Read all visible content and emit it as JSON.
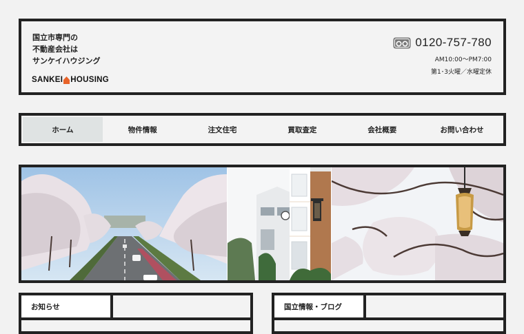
{
  "header": {
    "tagline": [
      "国立市専門の",
      "不動産会社は",
      "サンケイハウジング"
    ],
    "logo_left": "SANKEI",
    "logo_right": "HOUSING",
    "phone": "0120-757-780",
    "hours": "AM10:00～PM7:00",
    "closed": "第1･3火曜／水曜定休",
    "freedial_icon": "freedial-icon"
  },
  "nav": {
    "items": [
      "ホーム",
      "物件情報",
      "注文住宅",
      "買取査定",
      "会社概要",
      "お問い合わせ"
    ],
    "active": "ホーム"
  },
  "hero": {
    "panels": [
      "cherry-blossom-avenue",
      "building-with-lamp",
      "cherry-blossom-street-lamp"
    ]
  },
  "sections": {
    "news_title": "お知らせ",
    "blog_title": "国立情報・ブログ"
  },
  "colors": {
    "frame": "#222222",
    "background": "#f2f2f2",
    "nav_active": "#dfe3e3",
    "logo_accent": "#e8632a"
  }
}
